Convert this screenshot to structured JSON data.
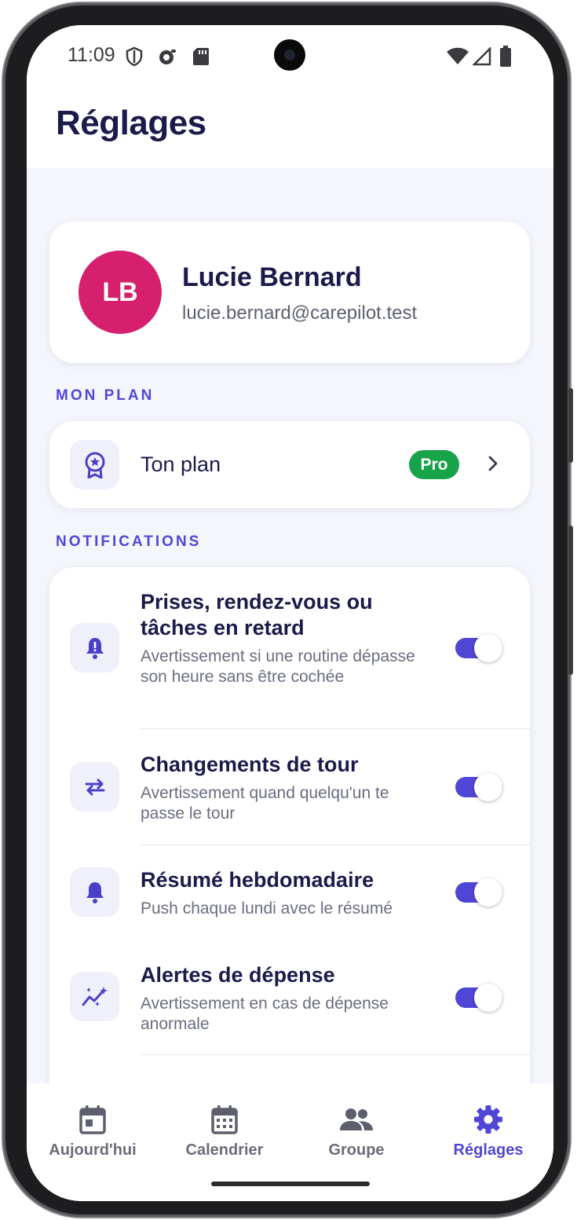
{
  "status_bar": {
    "time": "11:09"
  },
  "header": {
    "title": "Réglages"
  },
  "profile": {
    "initials": "LB",
    "name": "Lucie Bernard",
    "email": "lucie.bernard@carepilot.test",
    "avatar_color": "#d6206e"
  },
  "sections": {
    "plan_label": "MON PLAN",
    "notifications_label": "NOTIFICATIONS"
  },
  "plan": {
    "label": "Ton plan",
    "badge": "Pro",
    "badge_color": "#17a34a"
  },
  "notifications": [
    {
      "icon": "bell-alert-icon",
      "title": "Prises, rendez-vous ou tâches en retard",
      "description": "Avertissement si une routine dépasse son heure sans être cochée",
      "enabled": true
    },
    {
      "icon": "swap-arrows-icon",
      "title": "Changements de tour",
      "description": "Avertissement quand quelqu'un te passe le tour",
      "enabled": true
    },
    {
      "icon": "bell-icon",
      "title": "Résumé hebdomadaire",
      "description": "Push chaque lundi avec le résumé",
      "enabled": true
    },
    {
      "icon": "sparkle-chart-icon",
      "title": "Alertes de dépense",
      "description": "Avertissement en cas de dépense anormale",
      "enabled": true
    }
  ],
  "bottom_nav": [
    {
      "label": "Aujourd'hui",
      "icon": "calendar-day-icon",
      "active": false
    },
    {
      "label": "Calendrier",
      "icon": "calendar-grid-icon",
      "active": false
    },
    {
      "label": "Groupe",
      "icon": "group-icon",
      "active": false
    },
    {
      "label": "Réglages",
      "icon": "gear-icon",
      "active": true
    }
  ],
  "colors": {
    "accent": "#5046d6",
    "title_text": "#1c1a4a",
    "background": "#f4f6fb"
  }
}
